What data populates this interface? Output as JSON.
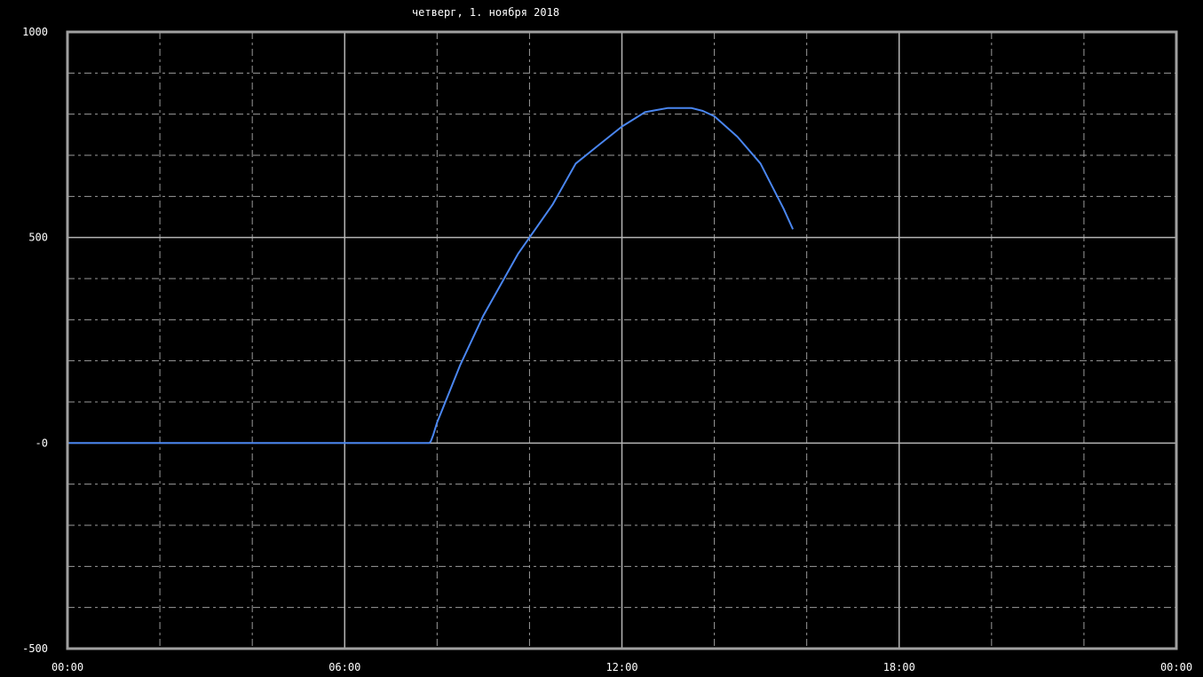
{
  "chart_data": {
    "type": "line",
    "title": "четверг, 1. ноября 2018",
    "xlabel": "",
    "ylabel": "",
    "xlim": [
      "00:00",
      "24:00"
    ],
    "ylim": [
      -500,
      1000
    ],
    "x_tick_labels": [
      "00:00",
      "06:00",
      "12:00",
      "18:00",
      "00:00"
    ],
    "y_tick_labels": [
      "1000",
      "500",
      "-0",
      "-500"
    ],
    "grid": true,
    "series": [
      {
        "color": "#4a86f0",
        "x": [
          "00:00",
          "07:50",
          "07:52",
          "07:55",
          "08:00",
          "08:30",
          "09:00",
          "09:30",
          "09:45",
          "10:00",
          "10:30",
          "11:00",
          "11:30",
          "12:00",
          "12:30",
          "12:45",
          "13:00",
          "13:15",
          "13:30",
          "13:45",
          "14:00",
          "14:30",
          "15:00",
          "15:15",
          "15:30",
          "15:42"
        ],
        "y": [
          0,
          0,
          5,
          20,
          50,
          190,
          310,
          410,
          460,
          500,
          580,
          680,
          725,
          770,
          805,
          810,
          815,
          815,
          815,
          808,
          795,
          745,
          680,
          625,
          570,
          520
        ]
      }
    ]
  },
  "style": {
    "background": "#000000",
    "frame_color": "#a0a0a0",
    "major_grid_color": "#b4b4b4",
    "minor_grid_color": "#9a9a9a",
    "text_color": "#ffffff"
  }
}
